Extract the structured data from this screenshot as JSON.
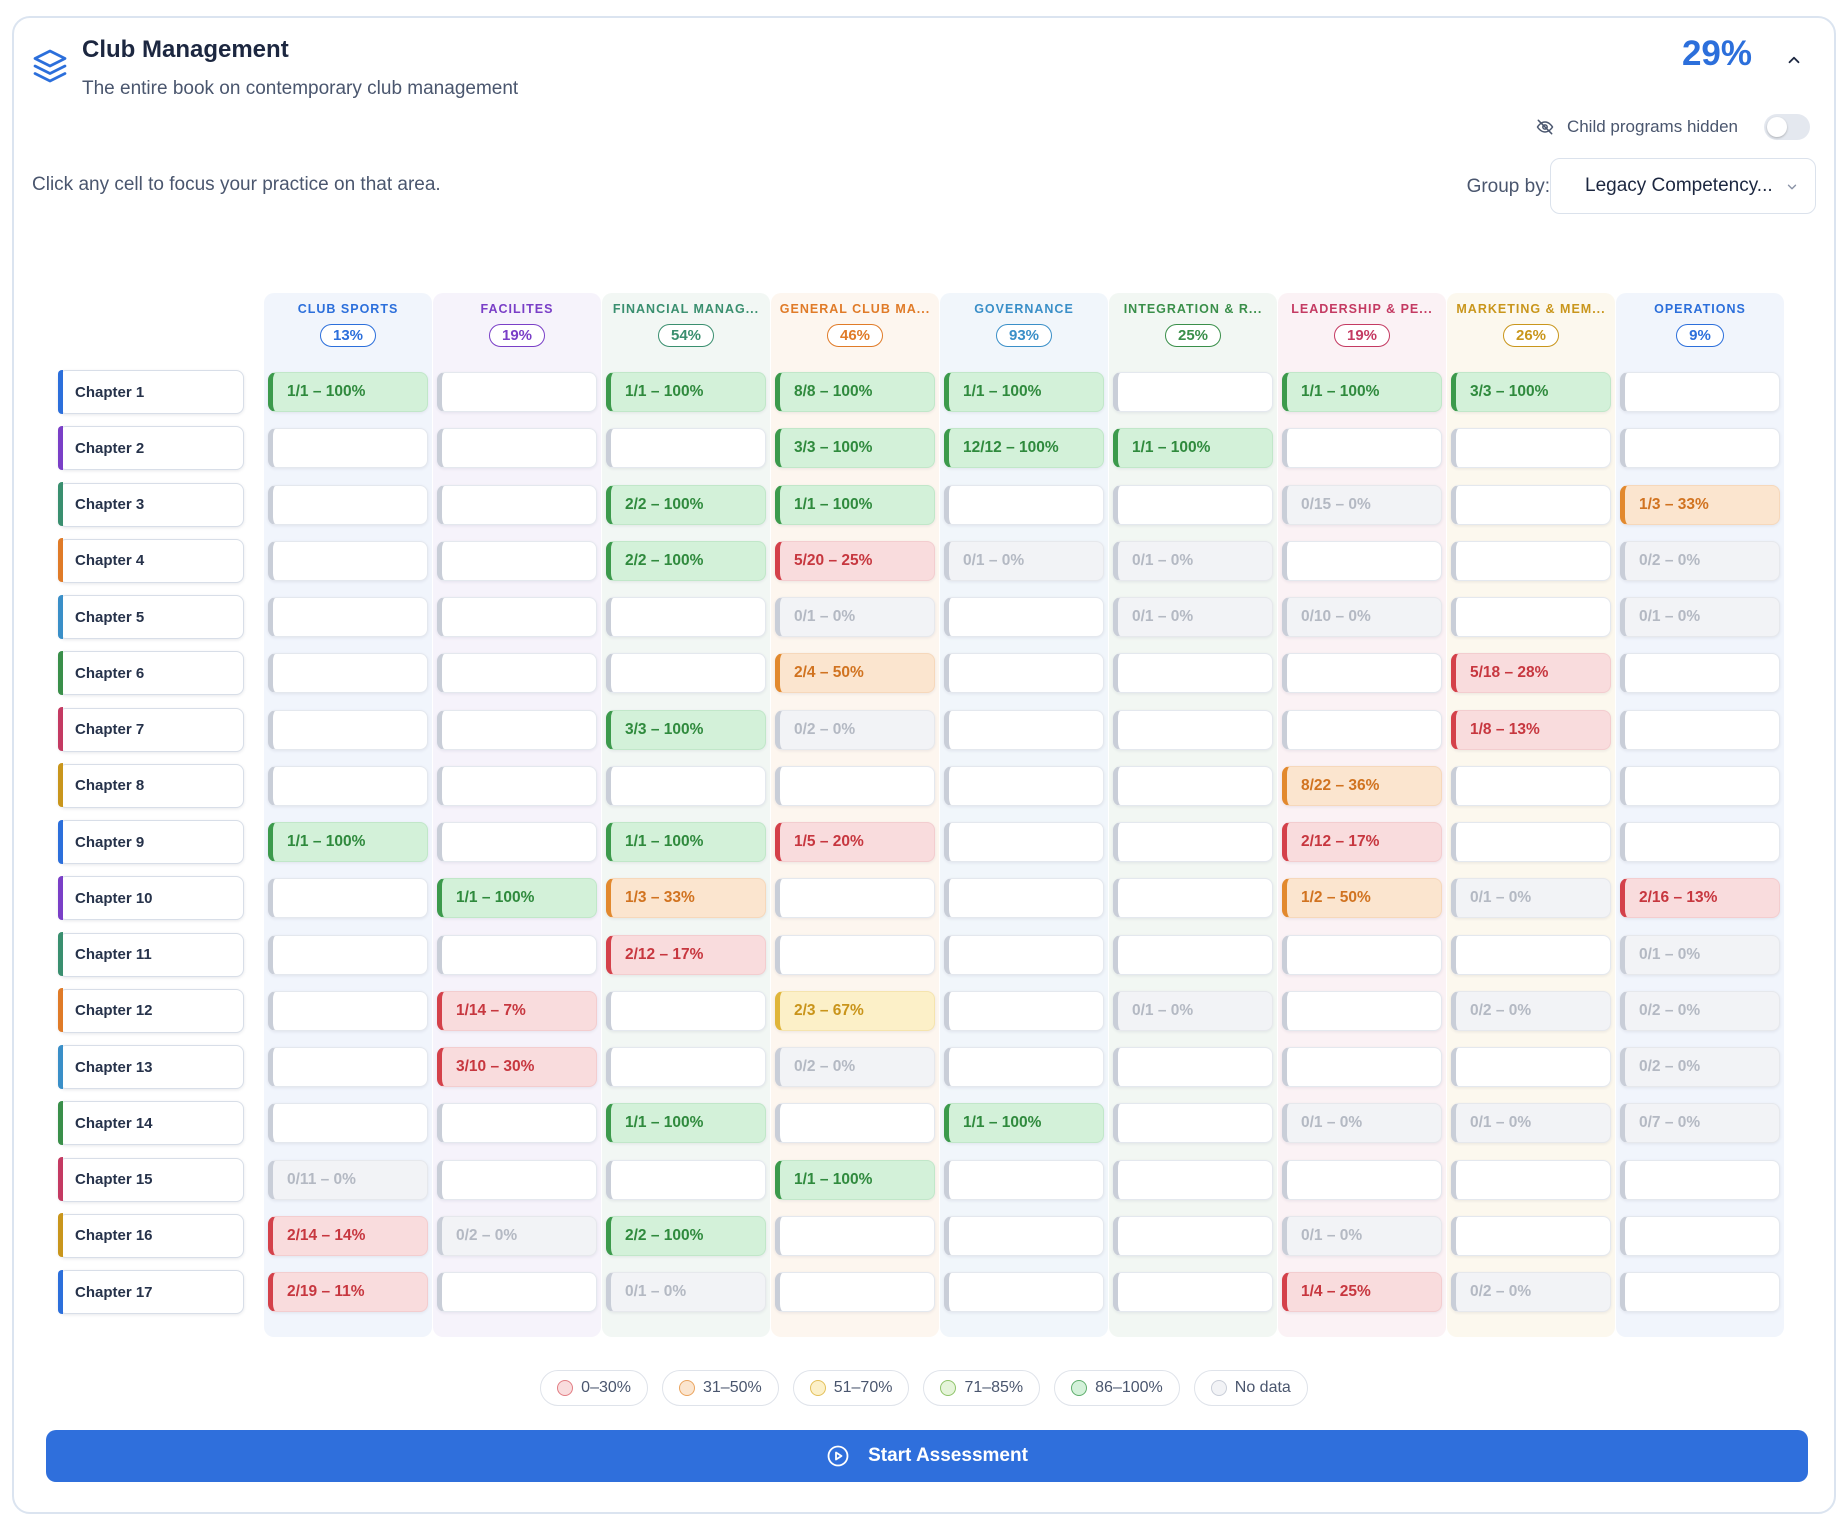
{
  "header": {
    "title": "Club Management",
    "subtitle": "The entire book on contemporary club management",
    "overall_pct": "29%",
    "child_programs_label": "Child programs hidden"
  },
  "controls": {
    "hint": "Click any cell to focus your practice on that area.",
    "group_by_label": "Group by:",
    "group_by_value": "Legacy Competency..."
  },
  "colors": {
    "accent": "#2f6fdc",
    "red": "#d4414a",
    "orange": "#e2892e",
    "yellow": "#e0b53a",
    "light_green": "#79b74e",
    "green": "#3c9a4c",
    "none": "#c9ced8"
  },
  "columns": [
    {
      "name": "CLUB SPORTS",
      "pct": "13%",
      "color": "#2c6fdb",
      "bg": "#f1f5fc"
    },
    {
      "name": "FACILITES",
      "pct": "19%",
      "color": "#7a3fc7",
      "bg": "#f6f3fb"
    },
    {
      "name": "FINANCIAL MANAG...",
      "pct": "54%",
      "color": "#3a8f6f",
      "bg": "#f2f7f4"
    },
    {
      "name": "GENERAL CLUB MA...",
      "pct": "46%",
      "color": "#e07b28",
      "bg": "#fdf6ef"
    },
    {
      "name": "GOVERNANCE",
      "pct": "93%",
      "color": "#3a8fc8",
      "bg": "#f1f6fb"
    },
    {
      "name": "INTEGRATION & R...",
      "pct": "25%",
      "color": "#3a8f4a",
      "bg": "#f2f7f3"
    },
    {
      "name": "LEADERSHIP & PE...",
      "pct": "19%",
      "color": "#c43a62",
      "bg": "#fbf2f5"
    },
    {
      "name": "MARKETING & MEM...",
      "pct": "26%",
      "color": "#c9961c",
      "bg": "#fcf8ee"
    },
    {
      "name": "OPERATIONS",
      "pct": "9%",
      "color": "#2c6fdb",
      "bg": "#f1f5fc"
    }
  ],
  "rows": [
    {
      "label": "Chapter 1",
      "color": "#2c6fdb",
      "cells": [
        [
          "green",
          "1/1 – 100%"
        ],
        [
          "empty",
          ""
        ],
        [
          "green",
          "1/1 – 100%"
        ],
        [
          "green",
          "8/8 – 100%"
        ],
        [
          "green",
          "1/1 – 100%"
        ],
        [
          "empty",
          ""
        ],
        [
          "green",
          "1/1 – 100%"
        ],
        [
          "green",
          "3/3 – 100%"
        ],
        [
          "empty",
          ""
        ]
      ]
    },
    {
      "label": "Chapter 2",
      "color": "#7a3fc7",
      "cells": [
        [
          "empty",
          ""
        ],
        [
          "empty",
          ""
        ],
        [
          "empty",
          ""
        ],
        [
          "green",
          "3/3 – 100%"
        ],
        [
          "green",
          "12/12 – 100%"
        ],
        [
          "green",
          "1/1 – 100%"
        ],
        [
          "empty",
          ""
        ],
        [
          "empty",
          ""
        ],
        [
          "empty",
          ""
        ]
      ]
    },
    {
      "label": "Chapter 3",
      "color": "#3a8f6f",
      "cells": [
        [
          "empty",
          ""
        ],
        [
          "empty",
          ""
        ],
        [
          "green",
          "2/2 – 100%"
        ],
        [
          "green",
          "1/1 – 100%"
        ],
        [
          "empty",
          ""
        ],
        [
          "empty",
          ""
        ],
        [
          "none",
          "0/15 – 0%"
        ],
        [
          "empty",
          ""
        ],
        [
          "orange",
          "1/3 – 33%"
        ]
      ]
    },
    {
      "label": "Chapter 4",
      "color": "#e07b28",
      "cells": [
        [
          "empty",
          ""
        ],
        [
          "empty",
          ""
        ],
        [
          "green",
          "2/2 – 100%"
        ],
        [
          "red",
          "5/20 – 25%"
        ],
        [
          "none",
          "0/1 – 0%"
        ],
        [
          "none",
          "0/1 – 0%"
        ],
        [
          "empty",
          ""
        ],
        [
          "empty",
          ""
        ],
        [
          "none",
          "0/2 – 0%"
        ]
      ]
    },
    {
      "label": "Chapter 5",
      "color": "#3a8fc8",
      "cells": [
        [
          "empty",
          ""
        ],
        [
          "empty",
          ""
        ],
        [
          "empty",
          ""
        ],
        [
          "none",
          "0/1 – 0%"
        ],
        [
          "empty",
          ""
        ],
        [
          "none",
          "0/1 – 0%"
        ],
        [
          "none",
          "0/10 – 0%"
        ],
        [
          "empty",
          ""
        ],
        [
          "none",
          "0/1 – 0%"
        ]
      ]
    },
    {
      "label": "Chapter 6",
      "color": "#3a8f4a",
      "cells": [
        [
          "empty",
          ""
        ],
        [
          "empty",
          ""
        ],
        [
          "empty",
          ""
        ],
        [
          "orange",
          "2/4 – 50%"
        ],
        [
          "empty",
          ""
        ],
        [
          "empty",
          ""
        ],
        [
          "empty",
          ""
        ],
        [
          "red",
          "5/18 – 28%"
        ],
        [
          "empty",
          ""
        ]
      ]
    },
    {
      "label": "Chapter 7",
      "color": "#c43a62",
      "cells": [
        [
          "empty",
          ""
        ],
        [
          "empty",
          ""
        ],
        [
          "green",
          "3/3 – 100%"
        ],
        [
          "none",
          "0/2 – 0%"
        ],
        [
          "empty",
          ""
        ],
        [
          "empty",
          ""
        ],
        [
          "empty",
          ""
        ],
        [
          "red",
          "1/8 – 13%"
        ],
        [
          "empty",
          ""
        ]
      ]
    },
    {
      "label": "Chapter 8",
      "color": "#c9961c",
      "cells": [
        [
          "empty",
          ""
        ],
        [
          "empty",
          ""
        ],
        [
          "empty",
          ""
        ],
        [
          "empty",
          ""
        ],
        [
          "empty",
          ""
        ],
        [
          "empty",
          ""
        ],
        [
          "orange",
          "8/22 – 36%"
        ],
        [
          "empty",
          ""
        ],
        [
          "empty",
          ""
        ]
      ]
    },
    {
      "label": "Chapter 9",
      "color": "#2c6fdb",
      "cells": [
        [
          "green",
          "1/1 – 100%"
        ],
        [
          "empty",
          ""
        ],
        [
          "green",
          "1/1 – 100%"
        ],
        [
          "red",
          "1/5 – 20%"
        ],
        [
          "empty",
          ""
        ],
        [
          "empty",
          ""
        ],
        [
          "red",
          "2/12 – 17%"
        ],
        [
          "empty",
          ""
        ],
        [
          "empty",
          ""
        ]
      ]
    },
    {
      "label": "Chapter 10",
      "color": "#7a3fc7",
      "cells": [
        [
          "empty",
          ""
        ],
        [
          "green",
          "1/1 – 100%"
        ],
        [
          "orange",
          "1/3 – 33%"
        ],
        [
          "empty",
          ""
        ],
        [
          "empty",
          ""
        ],
        [
          "empty",
          ""
        ],
        [
          "orange",
          "1/2 – 50%"
        ],
        [
          "none",
          "0/1 – 0%"
        ],
        [
          "red",
          "2/16 – 13%"
        ]
      ]
    },
    {
      "label": "Chapter 11",
      "color": "#3a8f6f",
      "cells": [
        [
          "empty",
          ""
        ],
        [
          "empty",
          ""
        ],
        [
          "red",
          "2/12 – 17%"
        ],
        [
          "empty",
          ""
        ],
        [
          "empty",
          ""
        ],
        [
          "empty",
          ""
        ],
        [
          "empty",
          ""
        ],
        [
          "empty",
          ""
        ],
        [
          "none",
          "0/1 – 0%"
        ]
      ]
    },
    {
      "label": "Chapter 12",
      "color": "#e07b28",
      "cells": [
        [
          "empty",
          ""
        ],
        [
          "red",
          "1/14 – 7%"
        ],
        [
          "empty",
          ""
        ],
        [
          "yellow",
          "2/3 – 67%"
        ],
        [
          "empty",
          ""
        ],
        [
          "none",
          "0/1 – 0%"
        ],
        [
          "empty",
          ""
        ],
        [
          "none",
          "0/2 – 0%"
        ],
        [
          "none",
          "0/2 – 0%"
        ]
      ]
    },
    {
      "label": "Chapter 13",
      "color": "#3a8fc8",
      "cells": [
        [
          "empty",
          ""
        ],
        [
          "red",
          "3/10 – 30%"
        ],
        [
          "empty",
          ""
        ],
        [
          "none",
          "0/2 – 0%"
        ],
        [
          "empty",
          ""
        ],
        [
          "empty",
          ""
        ],
        [
          "empty",
          ""
        ],
        [
          "empty",
          ""
        ],
        [
          "none",
          "0/2 – 0%"
        ]
      ]
    },
    {
      "label": "Chapter 14",
      "color": "#3a8f4a",
      "cells": [
        [
          "empty",
          ""
        ],
        [
          "empty",
          ""
        ],
        [
          "green",
          "1/1 – 100%"
        ],
        [
          "empty",
          ""
        ],
        [
          "green",
          "1/1 – 100%"
        ],
        [
          "empty",
          ""
        ],
        [
          "none",
          "0/1 – 0%"
        ],
        [
          "none",
          "0/1 – 0%"
        ],
        [
          "none",
          "0/7 – 0%"
        ]
      ]
    },
    {
      "label": "Chapter 15",
      "color": "#c43a62",
      "cells": [
        [
          "none",
          "0/11 – 0%"
        ],
        [
          "empty",
          ""
        ],
        [
          "empty",
          ""
        ],
        [
          "green",
          "1/1 – 100%"
        ],
        [
          "empty",
          ""
        ],
        [
          "empty",
          ""
        ],
        [
          "empty",
          ""
        ],
        [
          "empty",
          ""
        ],
        [
          "empty",
          ""
        ]
      ]
    },
    {
      "label": "Chapter 16",
      "color": "#c9961c",
      "cells": [
        [
          "red",
          "2/14 – 14%"
        ],
        [
          "none",
          "0/2 – 0%"
        ],
        [
          "green",
          "2/2 – 100%"
        ],
        [
          "empty",
          ""
        ],
        [
          "empty",
          ""
        ],
        [
          "empty",
          ""
        ],
        [
          "none",
          "0/1 – 0%"
        ],
        [
          "empty",
          ""
        ],
        [
          "empty",
          ""
        ]
      ]
    },
    {
      "label": "Chapter 17",
      "color": "#2c6fdb",
      "cells": [
        [
          "red",
          "2/19 – 11%"
        ],
        [
          "empty",
          ""
        ],
        [
          "none",
          "0/1 – 0%"
        ],
        [
          "empty",
          ""
        ],
        [
          "empty",
          ""
        ],
        [
          "empty",
          ""
        ],
        [
          "red",
          "1/4 – 25%"
        ],
        [
          "none",
          "0/2 – 0%"
        ],
        [
          "empty",
          ""
        ]
      ]
    }
  ],
  "legend": [
    {
      "label": "0–30%",
      "fill": "#f9dcdd",
      "stroke": "#e27d83"
    },
    {
      "label": "31–50%",
      "fill": "#fbe5cf",
      "stroke": "#eaa45f"
    },
    {
      "label": "51–70%",
      "fill": "#fcf0c8",
      "stroke": "#e3c05a"
    },
    {
      "label": "71–85%",
      "fill": "#e5f4d9",
      "stroke": "#8fc46a"
    },
    {
      "label": "86–100%",
      "fill": "#d3f1d9",
      "stroke": "#5fae6d"
    },
    {
      "label": "No data",
      "fill": "#f2f3f6",
      "stroke": "#c9ced8"
    }
  ],
  "start_button": {
    "label": "Start Assessment"
  }
}
